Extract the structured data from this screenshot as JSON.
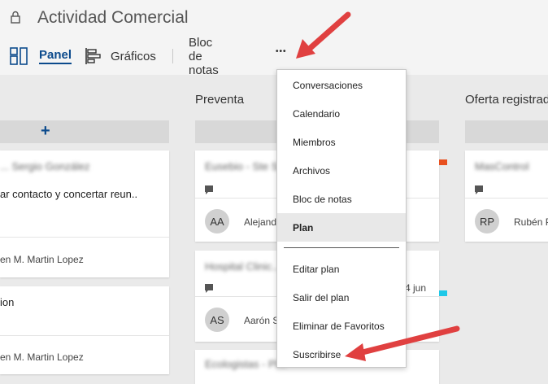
{
  "header": {
    "title": "Actividad Comercial",
    "tabs": {
      "panel": "Panel",
      "graficos": "Gráficos",
      "bloc": "Bloc de notas",
      "more": "•••"
    }
  },
  "columns": {
    "first": {
      "add_symbol": "+",
      "cards": [
        {
          "blurred_title": "... Sergio González",
          "text": "ar contacto y concertar reun..",
          "assignee": "en M. Martin Lopez"
        },
        {
          "text": "ion",
          "assignee": "en M. Martin Lopez"
        }
      ]
    },
    "preventa": {
      "title": "Preventa",
      "cards": [
        {
          "blurred_title": "Eusebio - Ste Si...",
          "avatar": "AA",
          "assignee": "Alejand"
        },
        {
          "blurred_title": "Hospital Clinic...",
          "date": "4 jun",
          "avatar": "AS",
          "assignee": "Aarón S"
        },
        {
          "blurred_title": "Ecologistas - Pl..."
        }
      ]
    },
    "oferta": {
      "title": "Oferta registrad",
      "cards": [
        {
          "blurred_title": "MasControl",
          "avatar": "RP",
          "assignee": "Rubén P"
        }
      ]
    }
  },
  "menu": {
    "items": [
      "Conversaciones",
      "Calendario",
      "Miembros",
      "Archivos",
      "Bloc de notas",
      "Plan",
      "Editar plan",
      "Salir del plan",
      "Eliminar de Favoritos",
      "Suscribirse"
    ],
    "active": "Plan"
  },
  "colors": {
    "accent": "#0b4a8c",
    "arrow": "#e04040",
    "tag_orange": "#e8501f",
    "tag_cyan": "#1ec8e8"
  }
}
